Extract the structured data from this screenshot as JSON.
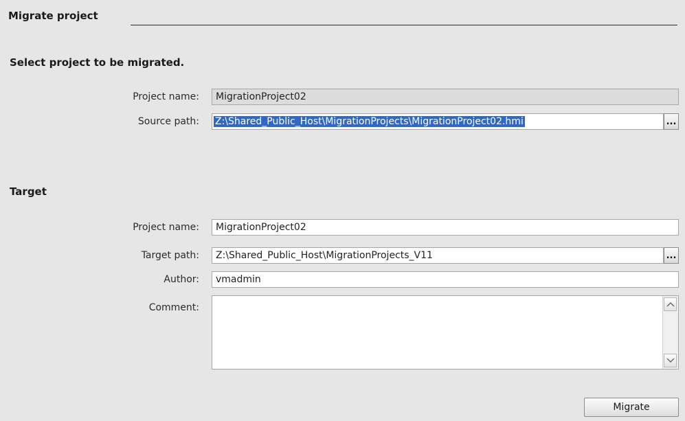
{
  "header": {
    "title": "Migrate project"
  },
  "source": {
    "title": "Select project to be migrated.",
    "project_name_label": "Project name:",
    "project_name_value": "MigrationProject02",
    "source_path_label": "Source path:",
    "source_path_value": "Z:\\Shared_Public_Host\\MigrationProjects\\MigrationProject02.hmi",
    "browse_label": "..."
  },
  "target": {
    "title": "Target",
    "project_name_label": "Project name:",
    "project_name_value": "MigrationProject02",
    "target_path_label": "Target path:",
    "target_path_value": "Z:\\Shared_Public_Host\\MigrationProjects_V11",
    "browse_label": "...",
    "author_label": "Author:",
    "author_value": "vmadmin",
    "comment_label": "Comment:",
    "comment_value": ""
  },
  "icons": {
    "scroll_up": "chevron-up-icon",
    "scroll_down": "chevron-down-icon"
  },
  "actions": {
    "migrate_label": "Migrate"
  },
  "colors": {
    "background": "#e6e6e6",
    "selection": "#3168c8"
  }
}
